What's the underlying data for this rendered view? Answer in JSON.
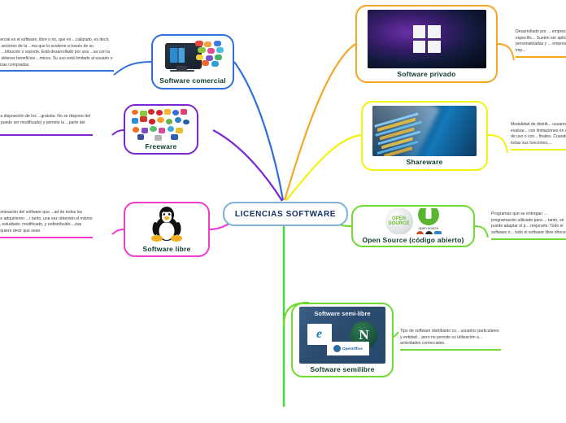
{
  "central": {
    "label": "LICENCIAS SOFTWARE",
    "border_color": "#7fb2d4",
    "text_color": "#14306b"
  },
  "nodes": [
    {
      "id": "software-comercial",
      "label": "Software comercial",
      "border_color": "#2f6fdd",
      "icon": "monitor-with-app-tiles-icon"
    },
    {
      "id": "freeware",
      "label": "Freeware",
      "border_color": "#7a28d6",
      "icon": "application-icons-collage-icon"
    },
    {
      "id": "software-libre",
      "label": "Software libre",
      "border_color": "#f13ad0",
      "icon": "linux-tux-penguin-icon"
    },
    {
      "id": "software-privado",
      "label": "Software privado",
      "border_color": "#f5a623",
      "icon": "windows-logo-icon"
    },
    {
      "id": "shareware",
      "label": "Shareware",
      "border_color": "#f2f20d",
      "icon": "blue-keyboard-tech-image-icon"
    },
    {
      "id": "open-source",
      "label": "Open Source (código abierto)",
      "border_color": "#6ddb2f",
      "icon": "open-source-logos-icon"
    },
    {
      "id": "software-semilibre",
      "label": "Software semilibre",
      "border_color": "#6ddb2f",
      "icon": "semi-free-software-browsers-icon",
      "image_caption": "Software semi-libre"
    }
  ],
  "notes": [
    {
      "id": "note-comercial",
      "rule_color": "#2f6fdd",
      "text": "...ware comercial es el software, libre o no, que es ...cializado, es decir, que existen sectores de la ...ma que lo sostiene a través de su producción, ...tribución o soporte. Está desarrollado por una ...sa con la finalidad de obtener beneficios ...micos. Su uso está limitado al usuario o número ...ncias compradas."
    },
    {
      "id": "note-freeware",
      "rule_color": "#7a28d6",
      "text": "...tor pone a disposición de los ...gratuita. No se dispone del código ...o puede ser modificado) y permite la ...parte del usuario."
    },
    {
      "id": "note-libre",
      "rule_color": "#f13ad0",
      "text": "...es la denominación del software que ...ad de todos los usuarios que adquirieron ...r tanto, una vez obtenido el mismo puede ...do, estudiado, modificado, y redistribuido ...rias formas. No quiere decir que sean"
    },
    {
      "id": "note-privado",
      "rule_color": "#f5a623",
      "text": "Desarrollado por ... empresa específic... Suelen ser aplicac... personalizadas y ... empresariales imp..."
    },
    {
      "id": "note-shareware",
      "rule_color": "#f2f20d",
      "text": "Modalidad de distrib... usuario puede evaluar... con limitaciones en e... formas de uso o con... finales. Cuando comp... todas sus funciones,..."
    },
    {
      "id": "note-opensource",
      "rule_color": "#6ddb2f",
      "text": "Programas que se entregan ... programación utilizado para ... tanto, se puede adaptar el p... mejorarlo. Todo el software o... todo el software libre ofrece y..."
    },
    {
      "id": "note-semilibre",
      "rule_color": "#6ddb2f",
      "text": "Tipo de software distribuido co... usuarios particulares y entidad... pero no permite su utilización a... actividades comerciales."
    }
  ]
}
